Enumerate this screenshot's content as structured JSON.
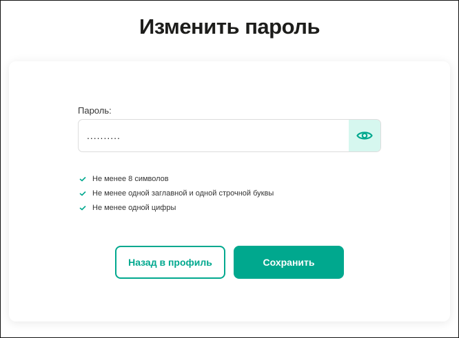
{
  "title": "Изменить пароль",
  "password": {
    "label": "Пароль:",
    "value": "..........",
    "toggle_icon": "eye-icon"
  },
  "requirements": [
    {
      "text": "Не менее 8 символов",
      "met": true
    },
    {
      "text": "Не менее одной заглавной и одной строчной буквы",
      "met": true
    },
    {
      "text": "Не менее одной цифры",
      "met": true
    }
  ],
  "buttons": {
    "back": "Назад в профиль",
    "save": "Сохранить"
  },
  "colors": {
    "accent": "#00a88e",
    "eye_bg": "#d6f7ef"
  }
}
